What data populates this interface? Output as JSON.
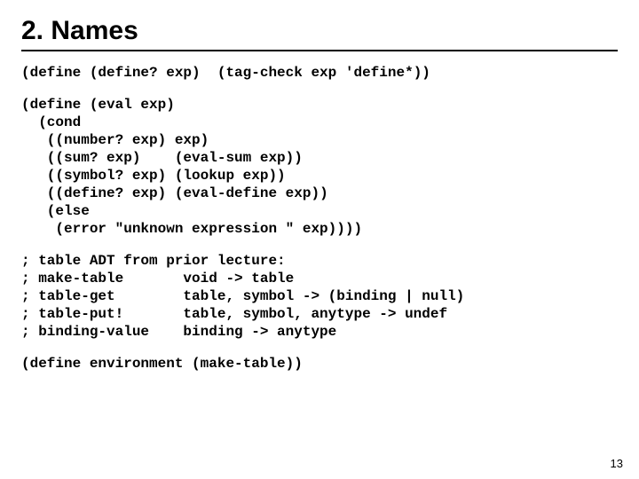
{
  "title": "2. Names",
  "code1": {
    "line1_a": "(define (define? exp)  (tag-check exp '",
    "line1_b": "define*",
    "line1_c": "))"
  },
  "code2": {
    "l1": "(define (eval exp)",
    "l2": "  (cond",
    "l3": "   ((number? exp) exp)",
    "l4": "   ((sum? exp)    (eval-sum exp))",
    "l5": "   ((symbol? exp) (lookup exp))",
    "l6a": "   ((define? exp) (",
    "l6b": "eval-define",
    "l6c": " exp))",
    "l7": "   (else",
    "l8": "    (error \"unknown expression \" exp))))"
  },
  "code3": {
    "l1": "; table ADT from prior lecture:",
    "l2": "; make-table       void -> table",
    "l3": "; table-get        table, symbol -> (binding | null)",
    "l4": "; table-put!       table, symbol, anytype -> undef",
    "l5": "; binding-value    binding -> anytype"
  },
  "code4": {
    "l1": "(define environment (make-table))"
  },
  "page_number": "13"
}
